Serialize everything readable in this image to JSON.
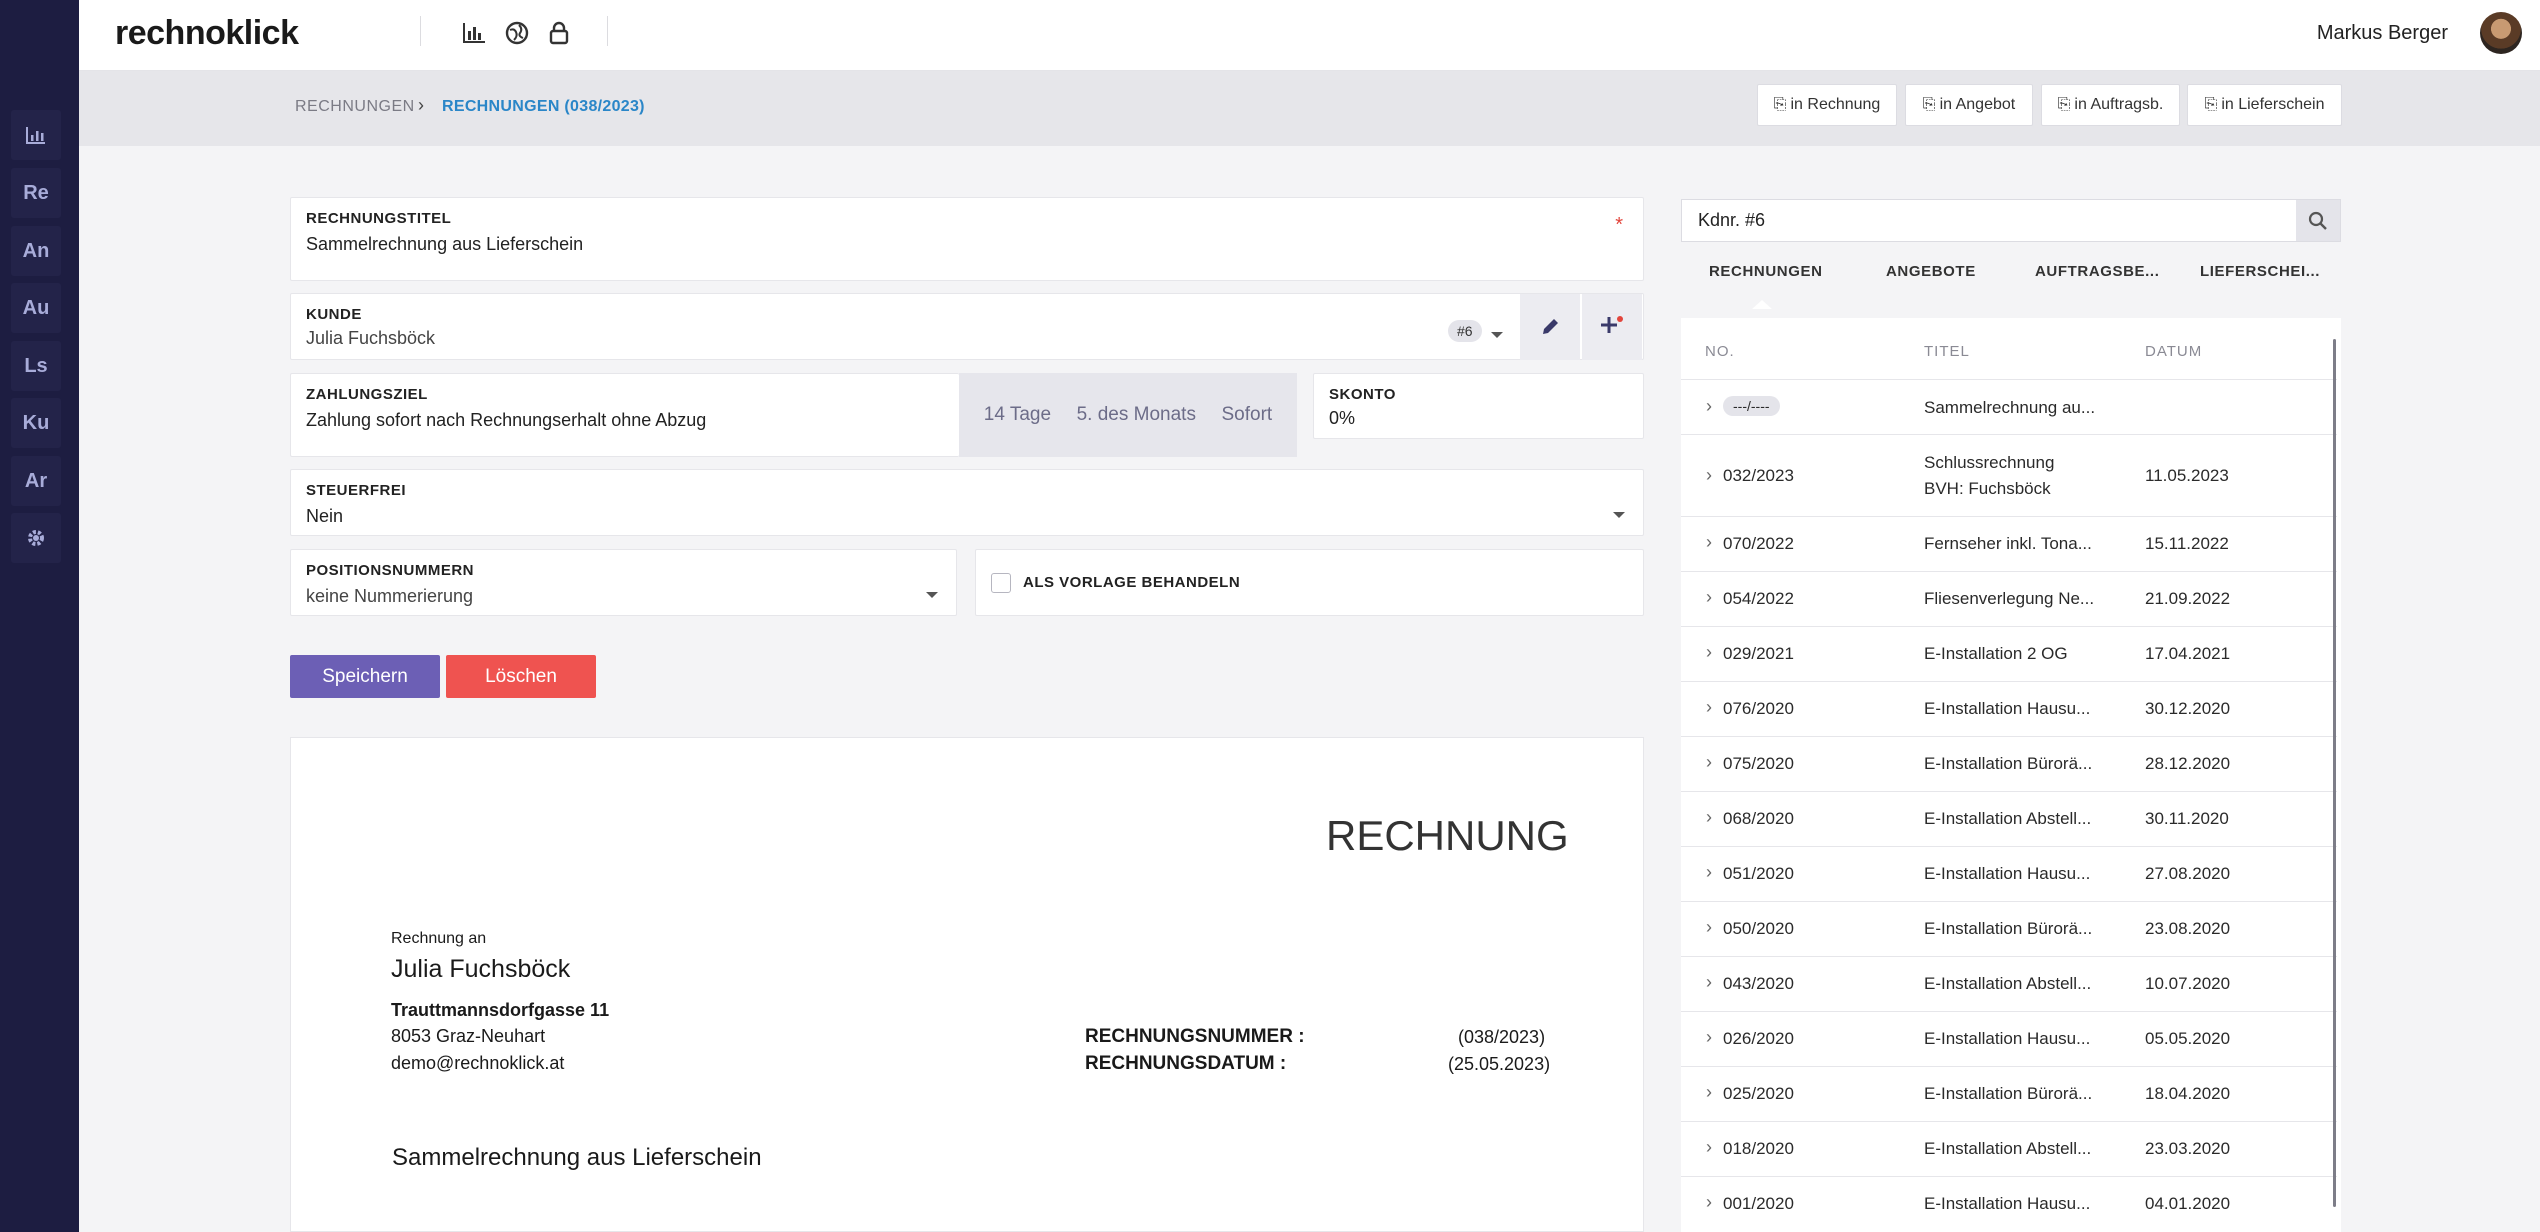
{
  "app": {
    "logo": "rechnoklick",
    "user": "Markus Berger"
  },
  "rail": {
    "items": [
      "Re",
      "An",
      "Au",
      "Ls",
      "Ku",
      "Ar"
    ]
  },
  "icons": {
    "rail_top": "chart-icon",
    "rail_bottom": "gear-icon",
    "top": [
      "chart-icon",
      "globe-icon",
      "lock-icon"
    ]
  },
  "breadcrumb": {
    "parent": "RECHNUNGEN",
    "current": "RECHNUNGEN (038/2023)"
  },
  "convert": [
    "in Rechnung",
    "in Angebot",
    "in Auftragsb.",
    "in Lieferschein"
  ],
  "form": {
    "title_label": "RECHNUNGSTITEL",
    "title_value": "Sammelrechnung aus Lieferschein",
    "required_mark": "*",
    "customer_label": "KUNDE",
    "customer_value": "Julia Fuchsböck",
    "customer_badge": "#6",
    "payment_label": "ZAHLUNGSZIEL",
    "payment_value": "Zahlung sofort nach Rechnungserhalt ohne Abzug",
    "payment_options": [
      "14 Tage",
      "5. des Monats",
      "Sofort"
    ],
    "discount_label": "SKONTO",
    "discount_value": "0%",
    "taxfree_label": "STEUERFREI",
    "taxfree_value": "Nein",
    "posnum_label": "POSITIONSNUMMERN",
    "posnum_value": "keine Nummerierung",
    "template_label": "ALS VORLAGE BEHANDELN",
    "save": "Speichern",
    "delete": "Löschen"
  },
  "preview": {
    "heading": "RECHNUNG",
    "to_label": "Rechnung an",
    "name": "Julia Fuchsböck",
    "street": "Trauttmannsdorfgasse 11",
    "city": "8053 Graz-Neuhart",
    "email": "demo@rechnoklick.at",
    "number_label": "RECHNUNGSNUMMER :",
    "number_value": "(038/2023)",
    "date_label": "RECHNUNGSDATUM :",
    "date_value": "(25.05.2023)",
    "subject": "Sammelrechnung aus Lieferschein"
  },
  "panel": {
    "search_value": "Kdnr. #6",
    "tabs": [
      "RECHNUNGEN",
      "ANGEBOTE",
      "AUFTRAGSBE...",
      "LIEFERSCHEI..."
    ],
    "headers": [
      "NO.",
      "TITEL",
      "DATUM"
    ],
    "rows": [
      {
        "no": "---/----",
        "title": "Sammelrechnung au...",
        "date": ""
      },
      {
        "no": "032/2023",
        "title": "Schlussrechnung",
        "title2": "BVH: Fuchsböck",
        "date": "11.05.2023"
      },
      {
        "no": "070/2022",
        "title": "Fernseher inkl. Tona...",
        "date": "15.11.2022"
      },
      {
        "no": "054/2022",
        "title": "Fliesenverlegung Ne...",
        "date": "21.09.2022"
      },
      {
        "no": "029/2021",
        "title": "E-Installation 2 OG",
        "date": "17.04.2021"
      },
      {
        "no": "076/2020",
        "title": "E-Installation Hausu...",
        "date": "30.12.2020"
      },
      {
        "no": "075/2020",
        "title": "E-Installation Bürorä...",
        "date": "28.12.2020"
      },
      {
        "no": "068/2020",
        "title": "E-Installation Abstell...",
        "date": "30.11.2020"
      },
      {
        "no": "051/2020",
        "title": "E-Installation Hausu...",
        "date": "27.08.2020"
      },
      {
        "no": "050/2020",
        "title": "E-Installation Bürorä...",
        "date": "23.08.2020"
      },
      {
        "no": "043/2020",
        "title": "E-Installation Abstell...",
        "date": "10.07.2020"
      },
      {
        "no": "026/2020",
        "title": "E-Installation Hausu...",
        "date": "05.05.2020"
      },
      {
        "no": "025/2020",
        "title": "E-Installation Bürorä...",
        "date": "18.04.2020"
      },
      {
        "no": "018/2020",
        "title": "E-Installation Abstell...",
        "date": "23.03.2020"
      },
      {
        "no": "001/2020",
        "title": "E-Installation Hausu...",
        "date": "04.01.2020"
      }
    ]
  },
  "colors": {
    "rail": "#1d1d41",
    "primary": "#6c5fb5",
    "danger": "#ef5350",
    "link": "#2a86c8"
  }
}
